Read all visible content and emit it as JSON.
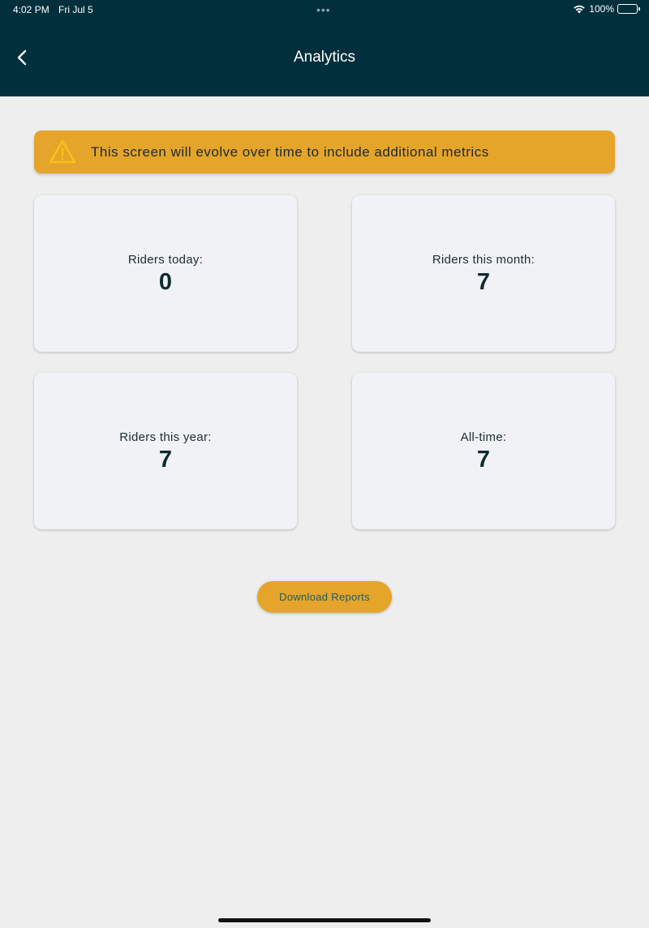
{
  "status_bar": {
    "time": "4:02 PM",
    "date": "Fri Jul 5",
    "battery": "100%",
    "multitasking_dots": "•••"
  },
  "header": {
    "title": "Analytics",
    "back_icon": "chevron-left-icon"
  },
  "banner": {
    "icon": "warning-icon",
    "text": "This screen will evolve over time to include additional metrics",
    "color": "#e5a52b"
  },
  "stats": [
    {
      "label": "Riders today:",
      "value": "0"
    },
    {
      "label": "Riders this month:",
      "value": "7"
    },
    {
      "label": "Riders this year:",
      "value": "7"
    },
    {
      "label": "All-time:",
      "value": "7"
    }
  ],
  "actions": {
    "download_label": "Download Reports"
  },
  "colors": {
    "header_bg": "#022f3c",
    "accent": "#e5a52b",
    "page_bg": "#eeeeee",
    "card_bg": "#f0f2f5"
  }
}
